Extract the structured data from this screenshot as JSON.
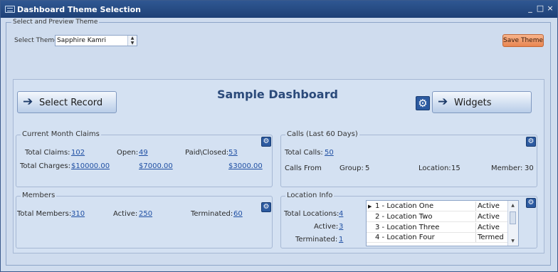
{
  "window": {
    "title": "Dashboard Theme Selection",
    "controls": [
      "_",
      "□",
      "×"
    ]
  },
  "theme": {
    "group_label": "Select and Preview Theme",
    "select_label": "Select Theme",
    "selected": "Sapphire Kamri",
    "save_label": "Save Theme"
  },
  "dashboard": {
    "title": "Sample Dashboard",
    "select_record": "Select Record",
    "widgets": "Widgets"
  },
  "claims": {
    "title": "Current Month Claims",
    "total_label": "Total Claims:",
    "total": "102",
    "open_label": "Open:",
    "open": "49",
    "paid_label": "Paid\\Closed:",
    "paid": "53",
    "charges_label": "Total Charges:",
    "charges_total": "$10000.00",
    "charges_open": "$7000.00",
    "charges_paid": "$3000.00"
  },
  "calls": {
    "title": "Calls (Last 60 Days)",
    "total_label": "Total Calls:",
    "total": "50",
    "from_label": "Calls From",
    "group_label": "Group:",
    "group": "5",
    "location_label": "Location:",
    "location": "15",
    "member_label": "Member:",
    "member": "30"
  },
  "members": {
    "title": "Members",
    "total_label": "Total Members:",
    "total": "310",
    "active_label": "Active:",
    "active": "250",
    "terminated_label": "Terminated:",
    "terminated": "60"
  },
  "locations": {
    "title": "Location Info",
    "total_label": "Total Locations:",
    "total": "4",
    "active_label": "Active:",
    "active": "3",
    "terminated_label": "Terminated:",
    "terminated": "1",
    "rows": [
      {
        "name": "1 - Location One",
        "status": "Active"
      },
      {
        "name": "2 - Location Two",
        "status": "Active"
      },
      {
        "name": "3 - Location Three",
        "status": "Active"
      },
      {
        "name": "4 - Location Four",
        "status": "Termed"
      }
    ]
  },
  "icons": {
    "window": "window-icon",
    "gear": "gear-icon",
    "arrow": "arrow-right-icon"
  },
  "colors": {
    "titlebar": "#2f5792",
    "save_button": "#e98550",
    "link": "#1f4fa3",
    "dashboard_title": "#2b4a7a"
  }
}
